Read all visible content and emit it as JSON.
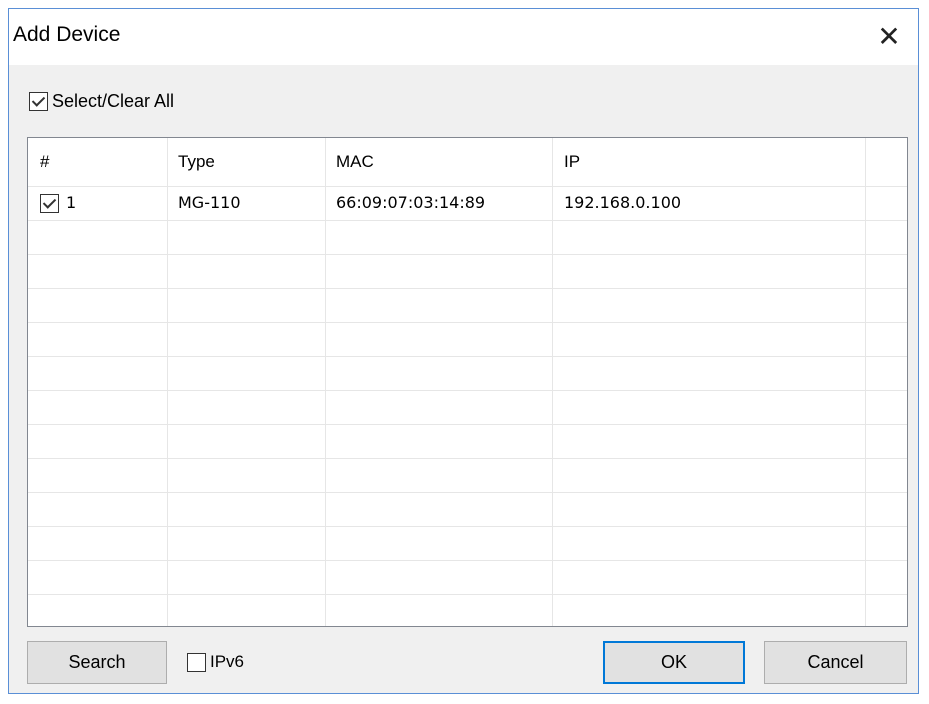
{
  "window": {
    "title": "Add Device",
    "close_glyph": "✕"
  },
  "select_all": {
    "label": "Select/Clear All",
    "checked": true
  },
  "table": {
    "columns": [
      "#",
      "Type",
      "MAC",
      "IP"
    ],
    "rows": [
      {
        "index": "1",
        "checked": true,
        "type": "MG-110",
        "mac": "66:09:07:03:14:89",
        "ip": "192.168.0.100"
      }
    ]
  },
  "footer": {
    "search_label": "Search",
    "ipv6_label": "IPv6",
    "ipv6_checked": false,
    "ok_label": "OK",
    "cancel_label": "Cancel"
  },
  "colors": {
    "accent": "#0078d7",
    "frame": "#5a8fd6",
    "dialog_bg": "#f0f0f0"
  }
}
